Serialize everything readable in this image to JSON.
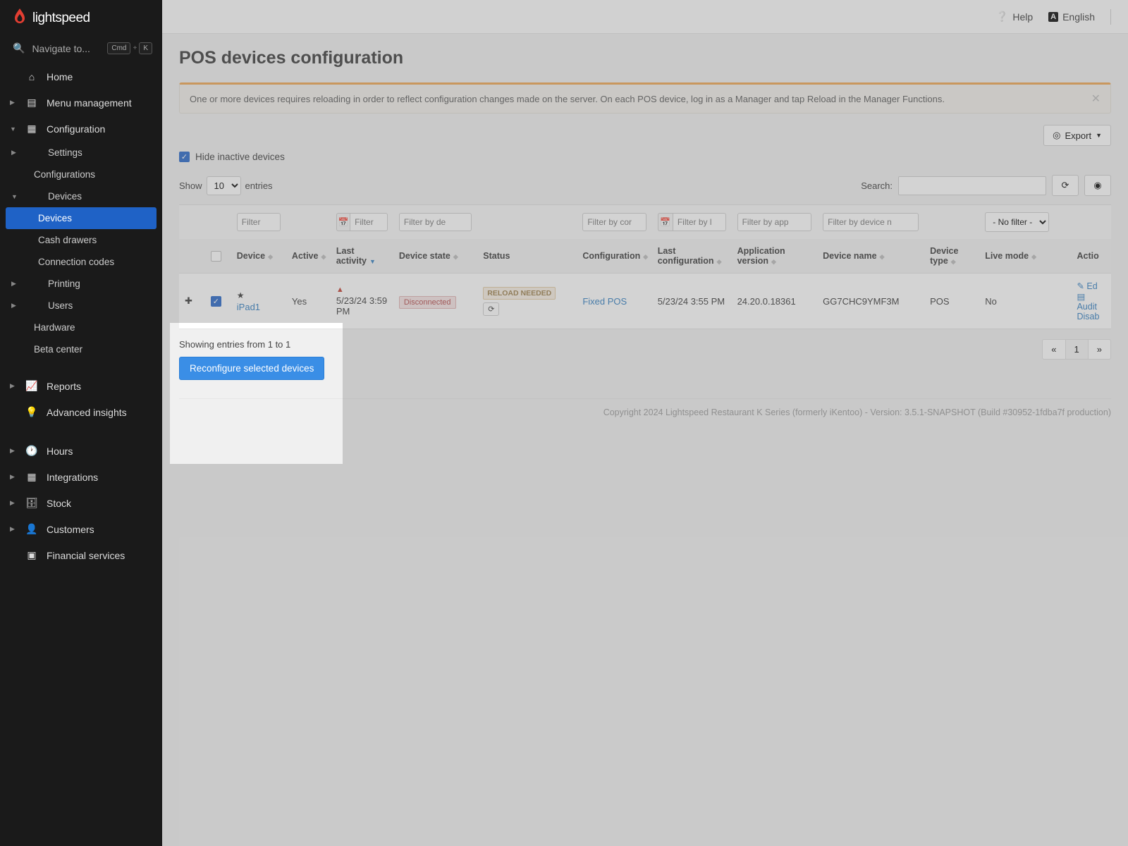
{
  "brand": "lightspeed",
  "navigateLabel": "Navigate to...",
  "kbd1": "Cmd",
  "kbd2": "K",
  "topbar": {
    "help": "Help",
    "lang": "English"
  },
  "nav": {
    "home": "Home",
    "menuMgmt": "Menu management",
    "config": "Configuration",
    "settings": "Settings",
    "configurations": "Configurations",
    "devicesGroup": "Devices",
    "devices": "Devices",
    "cashDrawers": "Cash drawers",
    "connCodes": "Connection codes",
    "printing": "Printing",
    "users": "Users",
    "hardware": "Hardware",
    "betaCenter": "Beta center",
    "reports": "Reports",
    "advInsights": "Advanced insights",
    "hours": "Hours",
    "integrations": "Integrations",
    "stock": "Stock",
    "customers": "Customers",
    "finServices": "Financial services"
  },
  "page": {
    "title": "POS devices configuration",
    "notice": "One or more devices requires reloading in order to reflect configuration changes made on the server. On each POS device, log in as a Manager and tap Reload in the Manager Functions.",
    "export": "Export",
    "hideInactive": "Hide inactive devices",
    "showPre": "Show",
    "showCount": "10",
    "showPost": "entries",
    "searchLabel": "Search:"
  },
  "columns": {
    "device": "Device",
    "active": "Active",
    "lastActivity": "Last activity",
    "deviceState": "Device state",
    "status": "Status",
    "configuration": "Configuration",
    "lastConfig": "Last configuration",
    "appVersion": "Application version",
    "deviceName": "Device name",
    "deviceType": "Device type",
    "liveMode": "Live mode",
    "actions": "Actio"
  },
  "filters": {
    "device": "Filter",
    "lastActivity": "Filter",
    "deviceState": "Filter by de",
    "configuration": "Filter by cor",
    "lastConfig": "Filter by l",
    "appVersion": "Filter by app",
    "deviceName": "Filter by device n",
    "liveMode": "- No filter -"
  },
  "row": {
    "deviceName": "iPad1",
    "active": "Yes",
    "lastActivity": "5/23/24 3:59 PM",
    "state": "Disconnected",
    "status": "RELOAD NEEDED",
    "configuration": "Fixed POS",
    "lastConfig": "5/23/24 3:55 PM",
    "appVersion": "24.20.0.18361",
    "devNameCode": "GG7CHC9YMF3M",
    "deviceType": "POS",
    "liveMode": "No",
    "actEdit": "Ed",
    "actAudit": "Audit",
    "actDisable": "Disab"
  },
  "bottom": {
    "showing": "Showing entries from 1 to 1",
    "reconfigure": "Reconfigure selected devices",
    "page": "1"
  },
  "footer": "Copyright 2024 Lightspeed Restaurant K Series (formerly iKentoo) - Version: 3.5.1-SNAPSHOT (Build #30952-1fdba7f production)"
}
